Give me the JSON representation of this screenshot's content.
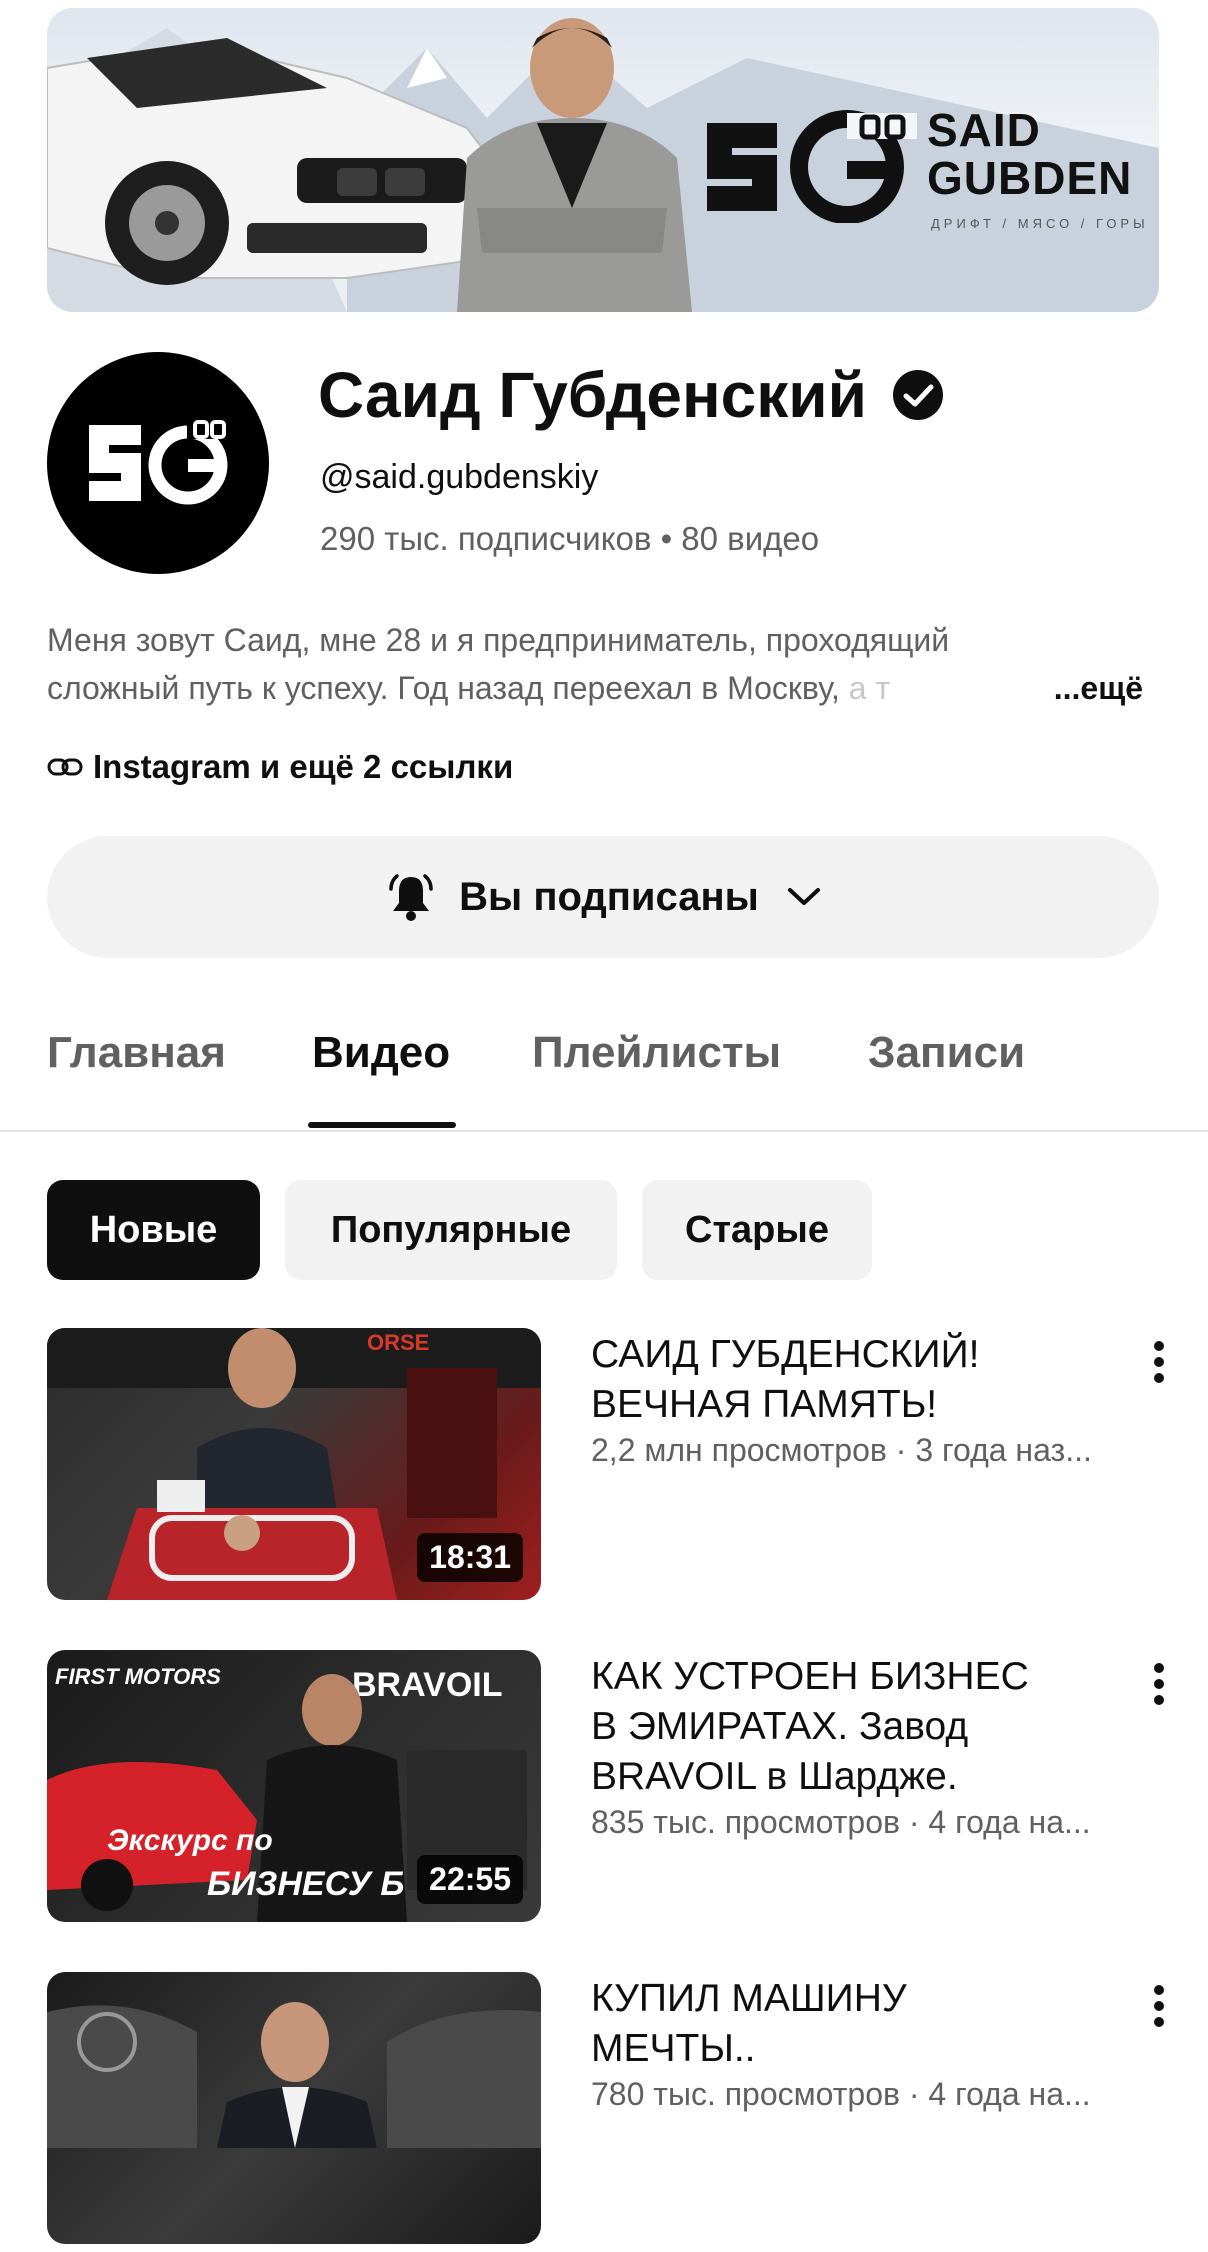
{
  "banner": {
    "name_line1": "SAID",
    "name_line2": "GUBDEN",
    "tagline": "ДРИФТ / МЯСО / ГОРЫ"
  },
  "channel": {
    "title": "Саид Губденский",
    "handle": "@said.gubdenskiy",
    "stats": "290 тыс. подписчиков • 80 видео",
    "description_line1": "Меня зовут Саид, мне 28 и я предприниматель, проходящий",
    "description_line2": "сложный путь к успеху. Год назад переехал в Москву, ",
    "description_fade": "а т",
    "more_label": "...ещё",
    "links_label": "Instagram и ещё 2 ссылки",
    "subscribe_label": "Вы подписаны"
  },
  "tabs": [
    "Главная",
    "Видео",
    "Плейлисты",
    "Записи"
  ],
  "active_tab": "Видео",
  "filters": [
    "Новые",
    "Популярные",
    "Старые"
  ],
  "active_filter": "Новые",
  "videos": [
    {
      "title_line1": "САИД ГУБДЕНСКИЙ!",
      "title_line2": "ВЕЧНАЯ ПАМЯТЬ!",
      "title_line3": "",
      "meta": "2,2 млн просмотров · 3 года наз...",
      "duration": "18:31",
      "thumb_text": "ORSE"
    },
    {
      "title_line1": "КАК УСТРОЕН БИЗНЕС",
      "title_line2": "В ЭМИРАТАХ. Завод",
      "title_line3": "BRAVOIL в Шардже.",
      "meta": "835 тыс. просмотров · 4 года на...",
      "duration": "22:55",
      "thumb_text": "BRAVOIL",
      "thumb_text2": "FIRST MOTORS",
      "thumb_text3": "Экскурс по",
      "thumb_text4": "БИЗНЕСУ Б"
    },
    {
      "title_line1": "КУПИЛ МАШИНУ",
      "title_line2": "МЕЧТЫ..",
      "title_line3": "",
      "meta": "780 тыс. просмотров · 4 года на...",
      "duration": ""
    }
  ],
  "colors": {
    "text_primary": "#0f0f0f",
    "text_secondary": "#606060",
    "chip_bg": "#f2f2f2"
  }
}
